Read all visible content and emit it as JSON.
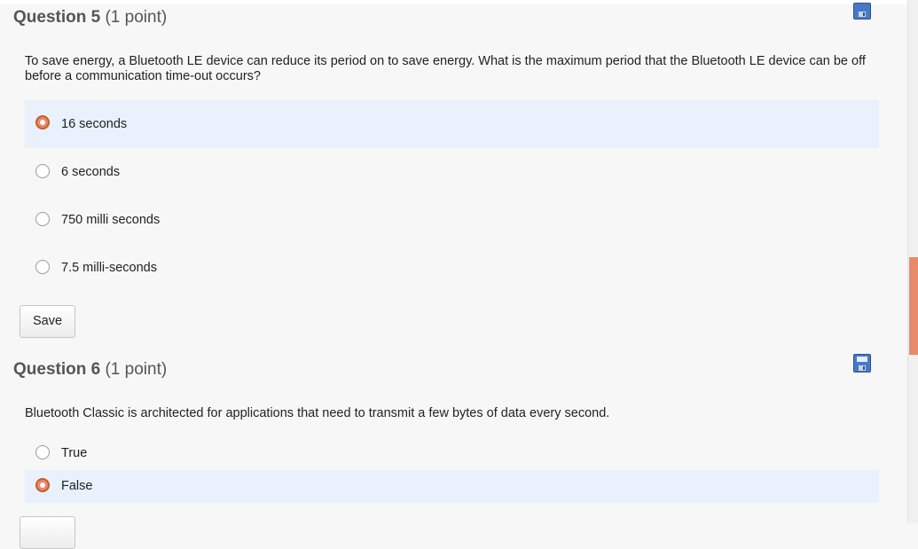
{
  "questions": [
    {
      "number_label": "Question 5",
      "points_label": "(1 point)",
      "text": "To save energy, a Bluetooth LE device can reduce its period on to save energy.  What is the maximum period that the Bluetooth LE device can be off before a communication time-out occurs?",
      "options": [
        {
          "label": "16 seconds",
          "selected": true
        },
        {
          "label": "6 seconds",
          "selected": false
        },
        {
          "label": "750 milli seconds",
          "selected": false
        },
        {
          "label": "7.5 milli-seconds",
          "selected": false
        }
      ],
      "save_label": "Save",
      "save_icon": "floppy-disk-icon"
    },
    {
      "number_label": "Question 6",
      "points_label": "(1 point)",
      "text": "Bluetooth Classic is architected for applications that need to transmit a few bytes of data every second.",
      "options": [
        {
          "label": "True",
          "selected": false
        },
        {
          "label": "False",
          "selected": true
        }
      ],
      "save_icon": "floppy-disk-icon"
    }
  ],
  "colors": {
    "accent": "#e8896a",
    "selected_bg": "#e8f1fc",
    "save_icon": "#4a78c8"
  }
}
